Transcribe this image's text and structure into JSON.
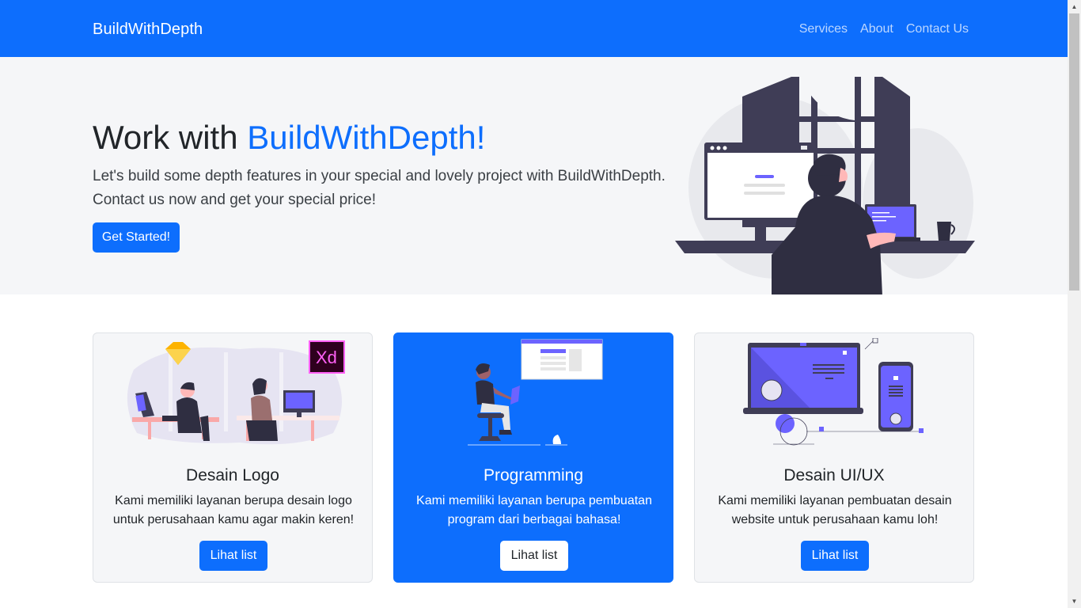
{
  "nav": {
    "brand": "BuildWithDepth",
    "links": [
      "Services",
      "About",
      "Contact Us"
    ]
  },
  "hero": {
    "title_prefix": "Work with ",
    "title_accent": "BuildWithDepth!",
    "lead": "Let's build some depth features in your special and lovely project with BuildWithDepth. Contact us now and get your special price!",
    "button_label": "Get Started!"
  },
  "cards": [
    {
      "title": "Desain Logo",
      "text": "Kami memiliki layanan berupa desain logo untuk perusahaan kamu agar makin keren!",
      "button_label": "Lihat list"
    },
    {
      "title": "Programming",
      "text": "Kami memiliki layanan berupa pembuatan program dari berbagai bahasa!",
      "button_label": "Lihat list"
    },
    {
      "title": "Desain UI/UX",
      "text": "Kami memiliki layanan pembuatan desain website untuk perusahaan kamu loh!",
      "button_label": "Lihat list"
    }
  ],
  "illustration_text": {
    "xd_logo": "Xd"
  },
  "colors": {
    "primary": "#0d6efd",
    "hero_bg": "#f5f6f8",
    "illustration_accent": "#6c63ff",
    "illustration_dark": "#3f3d56"
  }
}
